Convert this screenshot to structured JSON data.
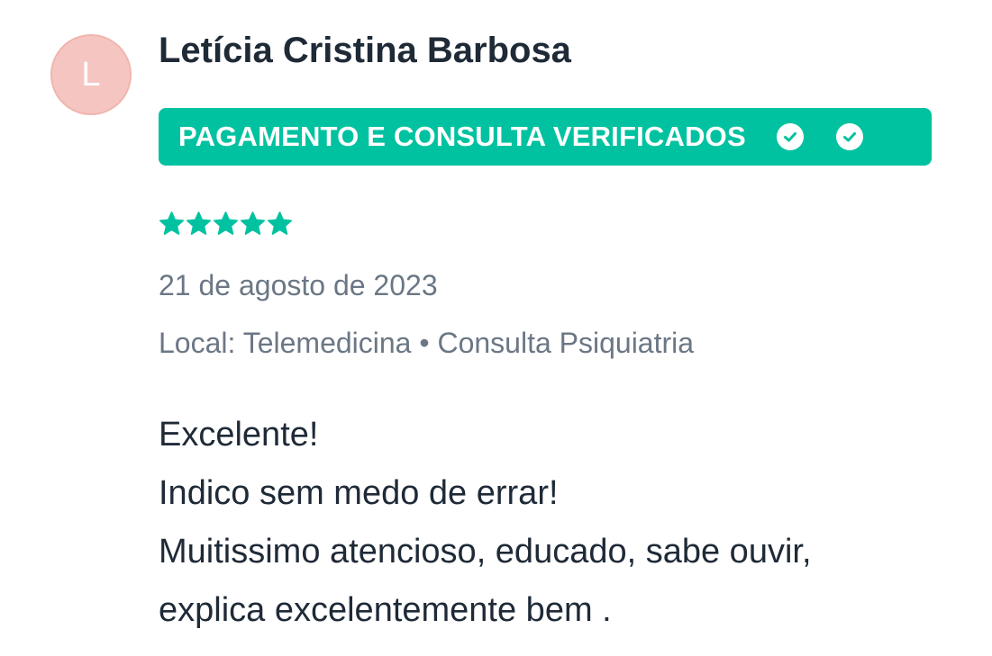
{
  "review": {
    "avatar_initial": "L",
    "author_name": "Letícia Cristina Barbosa",
    "badge_label": "PAGAMENTO E CONSULTA VERIFICADOS",
    "rating": 5,
    "rating_max": 5,
    "date": "21 de agosto de 2023",
    "location": "Local: Telemedicina",
    "separator": "•",
    "service": "Consulta Psiquiatria",
    "body_lines": [
      "Excelente!",
      "Indico sem medo de errar!",
      "Muitissimo atencioso, educado, sabe ouvir,",
      "explica excelentemente bem ."
    ]
  },
  "colors": {
    "accent": "#00c2a0",
    "avatar_bg": "#f5c6c1",
    "text_primary": "#1f2a37",
    "text_muted": "#6b7785"
  },
  "icons": {
    "check": "check-circle-icon",
    "star": "star-icon"
  }
}
